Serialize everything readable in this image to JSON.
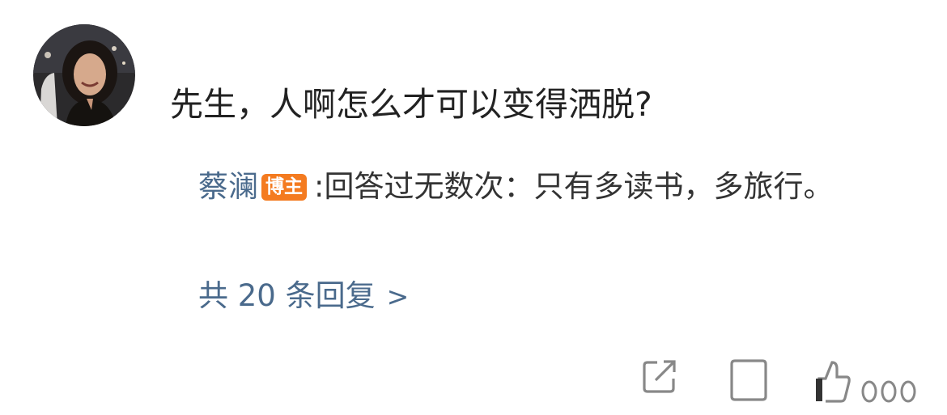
{
  "comment": {
    "text": "先生，人啊怎么才可以变得洒脱?"
  },
  "reply": {
    "author": "蔡澜",
    "badge": "博主",
    "separator": ":",
    "text": "回答过无数次：只有多读书，多旅行。"
  },
  "more_replies": {
    "label": "共 20 条回复",
    "chevron": ">"
  },
  "actions": {
    "icons": [
      "share-icon",
      "comment-icon",
      "like-icon"
    ]
  },
  "colors": {
    "link_blue": "#4a6a8c",
    "badge_orange": "#f47b20",
    "text_dark": "#222222",
    "icon_gray": "#888888"
  }
}
